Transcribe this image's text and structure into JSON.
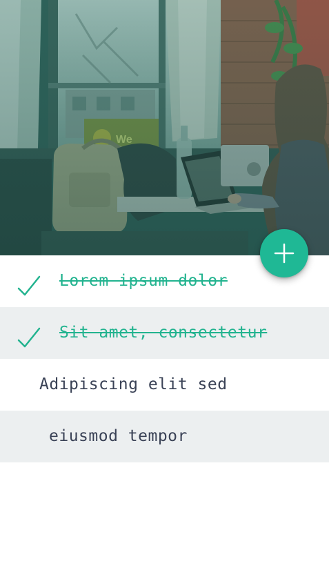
{
  "theme": {
    "accent": "#1fb895",
    "done_text": "#22b38f",
    "text": "#3a4256",
    "alt_row": "#eceff0",
    "hero_tint": "#2f5f57"
  },
  "hero": {
    "image_icon": "photo-woman-laptop-cafe",
    "sign_text": "We"
  },
  "fab": {
    "icon": "plus-icon"
  },
  "tasks": [
    {
      "label": "Lorem ipsum dolor",
      "done": true,
      "icon": "check-icon"
    },
    {
      "label": "Sit amet, consectetur",
      "done": true,
      "icon": "check-icon"
    },
    {
      "label": "Adipiscing elit sed",
      "done": false
    },
    {
      "label": "eiusmod tempor",
      "done": false
    }
  ]
}
